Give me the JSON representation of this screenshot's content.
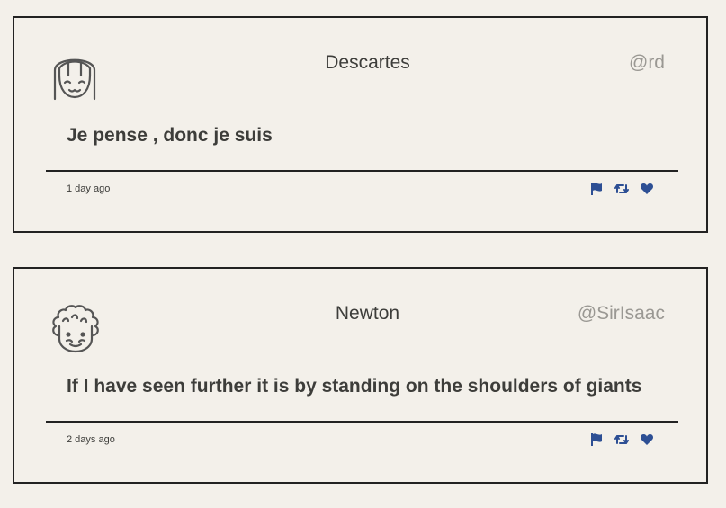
{
  "tweets": [
    {
      "name": "Descartes",
      "handle": "@rd",
      "message": "Je pense , donc je suis",
      "time": "1 day ago",
      "avatar_icon": "girl-face-icon"
    },
    {
      "name": "Newton",
      "handle": "@SirIsaac",
      "message": "If I have seen further it is by standing on the shoulders of giants",
      "time": "2 days ago",
      "avatar_icon": "curly-hair-face-icon"
    }
  ],
  "colors": {
    "background": "#f3f0ea",
    "text": "#3d3d3a",
    "handle": "#9a9893",
    "border": "#222222",
    "action_icon": "#2d4f94"
  },
  "action_icons": [
    "flag-icon",
    "retweet-icon",
    "heart-icon"
  ]
}
